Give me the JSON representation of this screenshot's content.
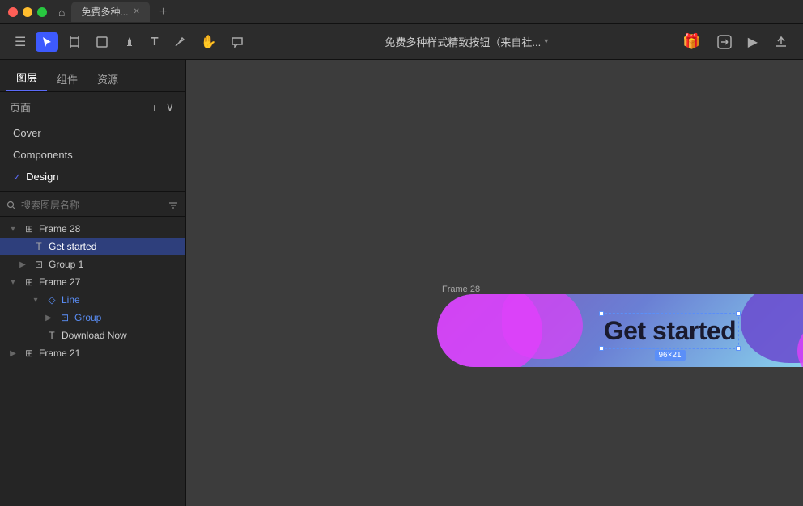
{
  "titlebar": {
    "tab_name": "免费多种...",
    "home_symbol": "⌂"
  },
  "toolbar": {
    "file_title": "免费多种样式精致按钮（来自社...",
    "dropdown": "▾",
    "tools": [
      "☰",
      "▶",
      "⊞",
      "□",
      "✦",
      "T",
      "✎",
      "✋",
      "○"
    ],
    "right_icons": [
      "🎁",
      "⬢",
      "▶",
      "↺"
    ]
  },
  "sidebar": {
    "tabs": [
      "图层",
      "组件",
      "资源"
    ],
    "pages_header": "页面",
    "pages": [
      {
        "name": "Cover",
        "active": false
      },
      {
        "name": "Components",
        "active": false
      },
      {
        "name": "Design",
        "active": true
      }
    ],
    "search_placeholder": "搜索图层名称",
    "layers": [
      {
        "id": "frame28",
        "name": "Frame 28",
        "icon": "⊞",
        "indent": 0,
        "expanded": true,
        "expandable": true
      },
      {
        "id": "get-started",
        "name": "Get started",
        "icon": "T",
        "indent": 1,
        "selected": true
      },
      {
        "id": "group1",
        "name": "Group 1",
        "icon": "⊡",
        "indent": 1,
        "expandable": true
      },
      {
        "id": "frame27",
        "name": "Frame 27",
        "icon": "⊞",
        "indent": 0,
        "expanded": true,
        "expandable": true
      },
      {
        "id": "line",
        "name": "Line",
        "icon": "◇",
        "indent": 2,
        "expandable": true,
        "highlighted": true
      },
      {
        "id": "group",
        "name": "Group",
        "icon": "⊡",
        "indent": 3,
        "highlighted": true,
        "expandable": true
      },
      {
        "id": "download-now",
        "name": "Download Now",
        "icon": "T",
        "indent": 2
      },
      {
        "id": "frame21",
        "name": "Frame 21",
        "icon": "⊞",
        "indent": 0,
        "expandable": true
      }
    ]
  },
  "canvas": {
    "frame_label": "Frame 28",
    "button_text": "Get started",
    "size_badge": "96×21"
  }
}
